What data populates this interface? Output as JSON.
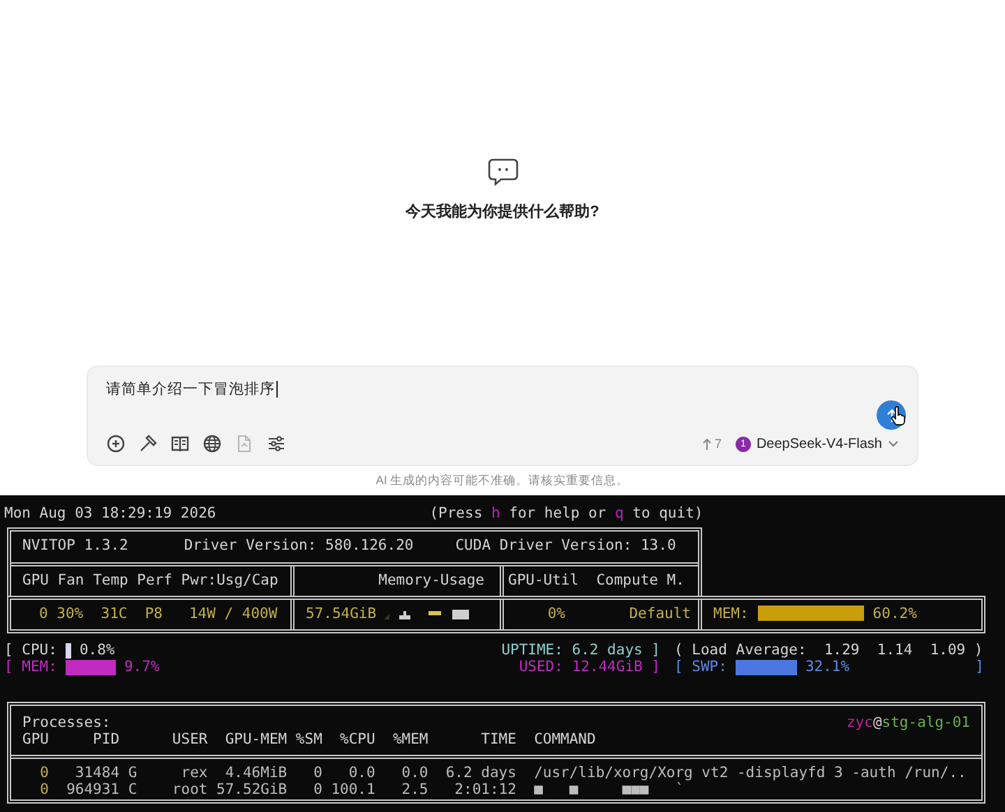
{
  "welcome": {
    "title": "今天我能为你提供什么帮助?"
  },
  "composer": {
    "value": "请简单介绍一下冒泡排序",
    "tools": [
      {
        "kind": "add",
        "disabled": false
      },
      {
        "kind": "hammer",
        "disabled": false
      },
      {
        "kind": "book",
        "disabled": false
      },
      {
        "kind": "globe",
        "disabled": false
      },
      {
        "kind": "file",
        "disabled": true
      },
      {
        "kind": "sliders",
        "disabled": false
      }
    ],
    "token_count": "7",
    "model": {
      "badge": "1",
      "name": "DeepSeek-V4-Flash"
    }
  },
  "disclaimer": "AI 生成的内容可能不准确。请核实重要信息。",
  "terminal": {
    "clock": "Mon Aug 03 18:29:19 2026",
    "help": [
      {
        "kind": "plain",
        "text": "(Press "
      },
      {
        "kind": "key",
        "text": "h"
      },
      {
        "kind": "plain",
        "text": " for help or "
      },
      {
        "kind": "key",
        "text": "q"
      },
      {
        "kind": "plain",
        "text": " to quit)"
      }
    ],
    "header": {
      "version": "NVITOP 1.3.2",
      "driver": "Driver Version: 580.126.20",
      "cuda": "CUDA Driver Version: 13.0",
      "columns": [
        "GPU Fan Temp Perf Pwr:Usg/Cap",
        "Memory-Usage",
        "GPU-Util  Compute M."
      ]
    },
    "gpus": [
      {
        "summary": "0 30%  31C  P8   14W / 400W",
        "memory": "57.54GiB",
        "util": "0%",
        "compute_mode": "Default",
        "mem_label": "MEM:",
        "mem_percent": "60.2%"
      }
    ],
    "host": {
      "cpu": {
        "label": "[ CPU:",
        "reading": "0.8%"
      },
      "uptime": "UPTIME: 6.2 days ]",
      "load": "( Load Average:  1.29  1.14  1.09 )",
      "mem": {
        "label": "[ MEM:",
        "reading": "9.7%"
      },
      "used": "USED: 12.44GiB ]",
      "swap": {
        "label": "[ SWP:",
        "reading": "32.1%",
        "close": "]"
      }
    },
    "processes": {
      "title": "Processes:",
      "user": "zyc",
      "at": "@",
      "host": "stg-alg-01",
      "columns": [
        "GPU",
        "PID",
        "USER",
        "GPU-MEM",
        "%SM",
        "%CPU",
        "%MEM",
        "TIME",
        "COMMAND"
      ],
      "rows": [
        {
          "gpu": "0",
          "pid": "31484",
          "type": "G",
          "user": "rex",
          "gpu_mem": "4.46MiB",
          "sm": "0",
          "cpu": "0.0",
          "mem": "0.0",
          "time": "6.2 days",
          "command": "/usr/lib/xorg/Xorg vt2 -displayfd 3 -auth /run/.."
        },
        {
          "gpu": "0",
          "pid": "964931",
          "type": "C",
          "user": "root",
          "gpu_mem": "57.52GiB",
          "sm": "0",
          "cpu": "100.1",
          "mem": "2.5",
          "time": "2:01:12",
          "command": "■   ■     ■■■   `"
        }
      ]
    }
  }
}
